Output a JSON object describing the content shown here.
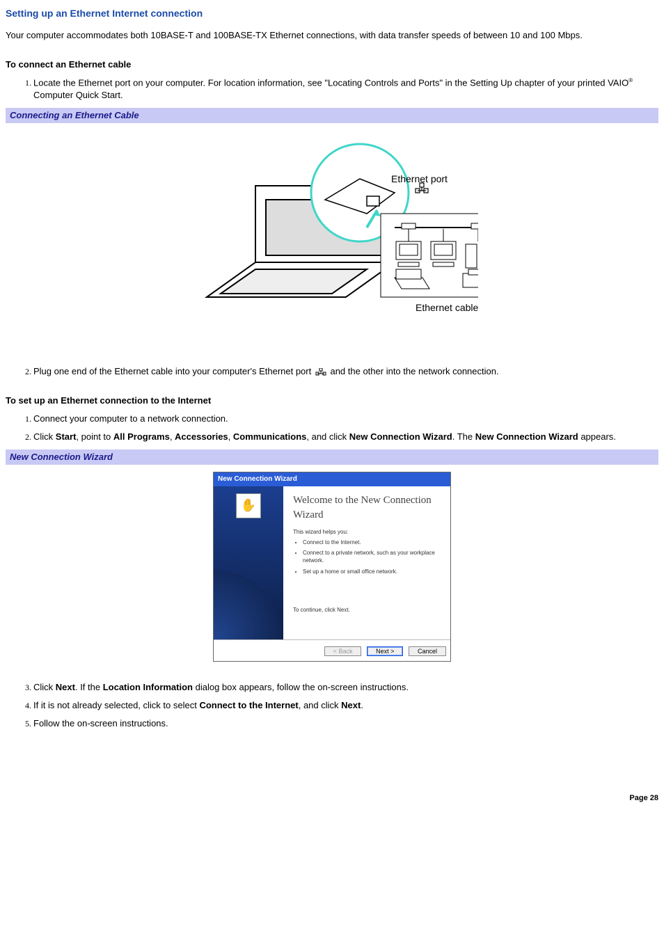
{
  "title": "Setting up an Ethernet Internet connection",
  "intro": "Your computer accommodates both 10BASE-T and 100BASE-TX Ethernet connections, with data transfer speeds of between 10 and 100 Mbps.",
  "section1_head": "To connect an Ethernet cable",
  "step1_pre": "Locate the Ethernet port on your computer. For location information, see \"Locating Controls and Ports\" in the Setting Up chapter of your printed VAIO",
  "step1_post": " Computer Quick Start.",
  "reg_mark": "®",
  "fig1_caption": "Connecting an Ethernet Cable",
  "fig1_label_port": "Ethernet port",
  "fig1_label_cable": "Ethernet cable",
  "step2_pre": "Plug one end of the Ethernet cable into your computer's Ethernet port ",
  "step2_post": "and the other into the network connection.",
  "section2_head": "To set up an Ethernet connection to the Internet",
  "s2_step1": "Connect your computer to a network connection.",
  "s2_step2_parts": {
    "p0": "Click ",
    "b0": "Start",
    "p1": ", point to ",
    "b1": "All Programs",
    "p2": ", ",
    "b2": "Accessories",
    "p3": ", ",
    "b3": "Communications",
    "p4": ", and click ",
    "b4": "New Connection Wizard",
    "p5": ". The ",
    "b5": "New Connection Wizard",
    "p6": " appears."
  },
  "fig2_caption": "New Connection Wizard",
  "wizard": {
    "titlebar": "New Connection Wizard",
    "welcome": "Welcome to the New Connection Wizard",
    "helps": "This wizard helps you:",
    "b1": "Connect to the Internet.",
    "b2": "Connect to a private network, such as your workplace network.",
    "b3": "Set up a home or small office network.",
    "continue": "To continue, click Next.",
    "back": "< Back",
    "next": "Next >",
    "cancel": "Cancel"
  },
  "s2_step3_parts": {
    "p0": "Click ",
    "b0": "Next",
    "p1": ". If the ",
    "b1": "Location Information",
    "p2": " dialog box appears, follow the on-screen instructions."
  },
  "s2_step4_parts": {
    "p0": "If it is not already selected, click to select ",
    "b0": "Connect to the Internet",
    "p1": ", and click ",
    "b1": "Next",
    "p2": "."
  },
  "s2_step5": "Follow the on-screen instructions.",
  "page_num": "Page 28"
}
